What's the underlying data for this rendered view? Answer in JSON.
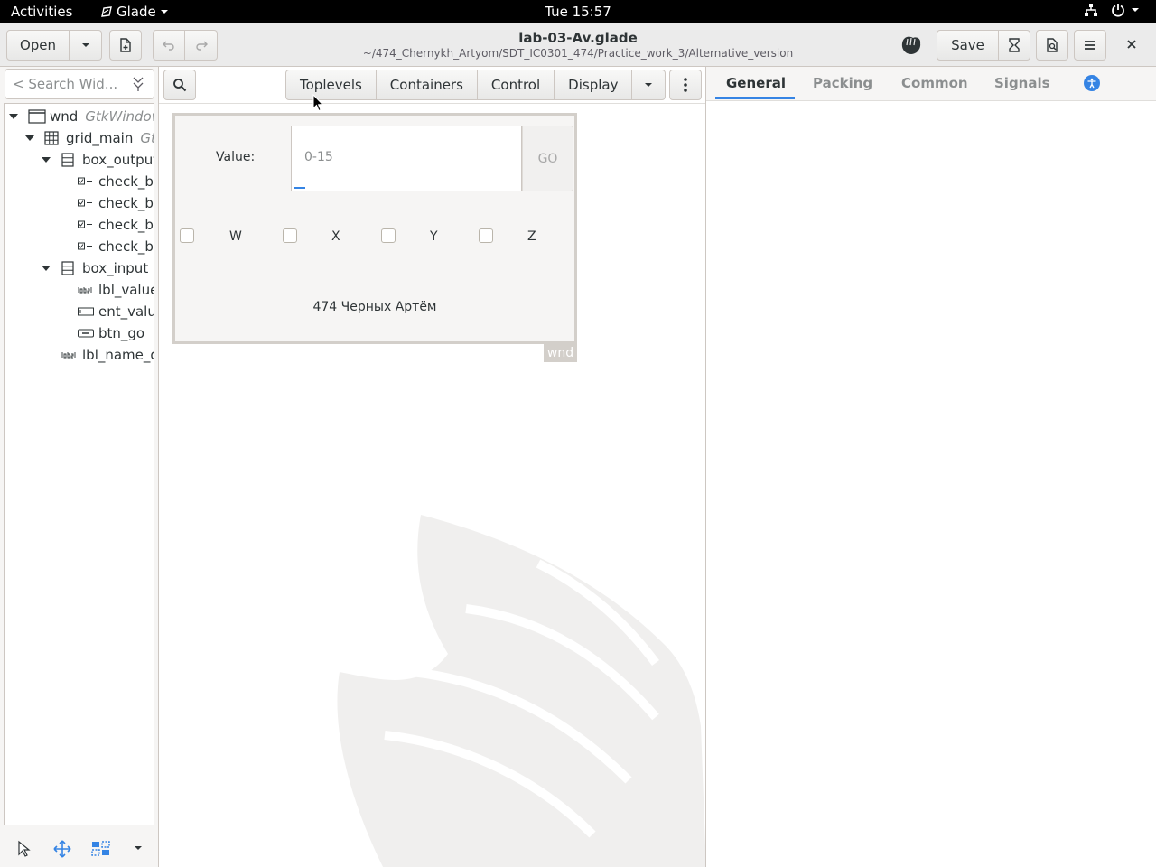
{
  "topbar": {
    "activities": "Activities",
    "app_name": "Glade",
    "clock": "Tue 15:57"
  },
  "header": {
    "open_label": "Open",
    "save_label": "Save",
    "title": "lab-03-Av.glade",
    "subtitle": "~/474_Chernykh_Artyom/SDT_IC0301_474/Practice_work_3/Alternative_version"
  },
  "inspector": {
    "search_placeholder": "< Search Wid...",
    "tree": [
      {
        "name": "wnd",
        "cls": "GtkWindow"
      },
      {
        "name": "grid_main",
        "cls": "GtkGrid"
      },
      {
        "name": "box_output",
        "cls": ""
      },
      {
        "name": "check_btn_w",
        "cls": ""
      },
      {
        "name": "check_btn_x",
        "cls": ""
      },
      {
        "name": "check_btn_y",
        "cls": ""
      },
      {
        "name": "check_btn_z",
        "cls": ""
      },
      {
        "name": "box_input",
        "cls": ""
      },
      {
        "name": "lbl_value",
        "cls": ""
      },
      {
        "name": "ent_value",
        "cls": ""
      },
      {
        "name": "btn_go",
        "cls": ""
      },
      {
        "name": "lbl_name_developer",
        "cls": ""
      }
    ]
  },
  "palette": {
    "tabs": [
      "Toplevels",
      "Containers",
      "Control",
      "Display"
    ]
  },
  "design": {
    "value_label": "Value:",
    "entry_placeholder": "0-15",
    "go_label": "GO",
    "checks": [
      "W",
      "X",
      "Y",
      "Z"
    ],
    "name_label": "474 Черных Артём",
    "window_tag": "wnd"
  },
  "properties": {
    "tabs": [
      "General",
      "Packing",
      "Common",
      "Signals"
    ],
    "active_tab": "General"
  },
  "colors": {
    "accent": "#3584e4",
    "topbar": "#000000",
    "headerbar": "#ebebeb"
  }
}
